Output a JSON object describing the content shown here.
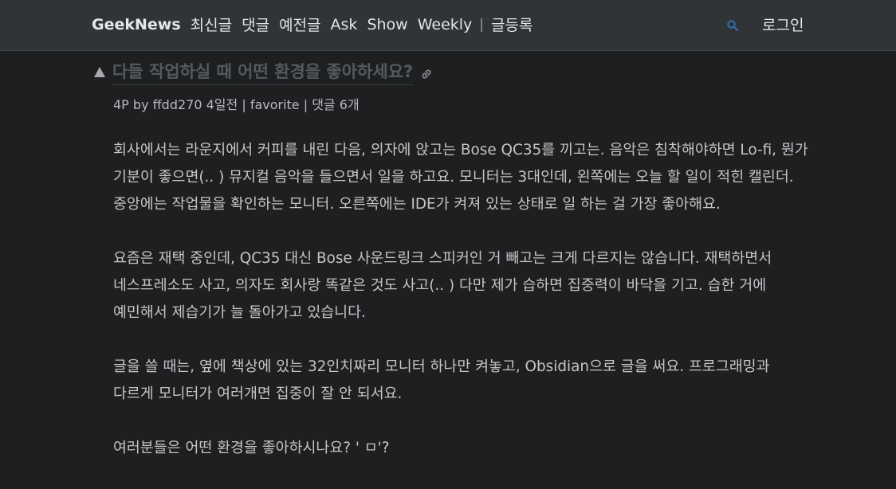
{
  "header": {
    "brand": "GeekNews",
    "nav": [
      "최신글",
      "댓글",
      "예전글",
      "Ask",
      "Show",
      "Weekly"
    ],
    "separator": "|",
    "submit": "글등록",
    "search_icon": "search-icon",
    "login": "로그인"
  },
  "topic": {
    "title": "다들 작업하실 때 어떤 환경을 좋아하세요?",
    "points": "4P",
    "by": "by",
    "author": "ffdd270",
    "time": "4일전",
    "favorite": "favorite",
    "comments": "댓글 6개",
    "meta_sep": "|"
  },
  "content": {
    "paragraphs": [
      "회사에서는 라운지에서 커피를 내린 다음, 의자에 앉고는 Bose QC35를 끼고는. 음악은 침착해야하면 Lo-fi, 뭔가 기분이 좋으면(.. ) 뮤지컬 음악을 들으면서 일을 하고요. 모니터는 3대인데, 왼쪽에는 오늘 할 일이 적힌 캘린더. 중앙에는 작업물을 확인하는 모니터. 오른쪽에는 IDE가 켜져 있는 상태로 일 하는 걸 가장 좋아해요.",
      "요즘은 재택 중인데, QC35 대신 Bose 사운드링크 스피커인 거 빼고는 크게 다르지는 않습니다. 재택하면서 네스프레소도 사고, 의자도 회사랑 똑같은 것도 사고(.. ) 다만 제가 습하면 집중력이 바닥을 기고. 습한 거에 예민해서 제습기가 늘 돌아가고 있습니다.",
      "글을 쓸 때는, 옆에 책상에 있는 32인치짜리 모니터 하나만 켜놓고, Obsidian으로 글을 써요. 프로그래밍과 다르게 모니터가 여러개면 집중이 잘 안 되서요.",
      "여러분들은 어떤 환경을 좋아하시나요? ' ㅁ'?"
    ]
  },
  "colors": {
    "background": "#1e1f21",
    "header_bg": "#313437",
    "title": "#56595c",
    "text": "#c4c5c7",
    "search_icon": "#2f6fb0"
  }
}
